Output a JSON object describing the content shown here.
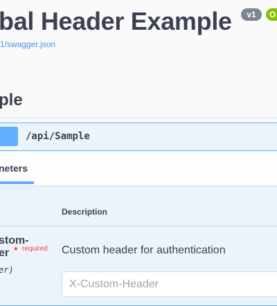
{
  "info": {
    "title": "bal Header Example",
    "version_badge": "v1",
    "oas_badge": "O",
    "spec_url": "1/swagger.json"
  },
  "section": {
    "title": "ple"
  },
  "operation": {
    "path": "/api/Sample",
    "method_color": "#61affe"
  },
  "parameters": {
    "tab_label": "neters",
    "header_description": "Description",
    "items": [
      {
        "name_line1": "stom-",
        "name_line2": "er",
        "required_star": "*",
        "required_label": "required",
        "type": "er)",
        "description": "Custom header for authentication",
        "placeholder": "X-Custom-Header"
      }
    ]
  },
  "colors": {
    "accent": "#61affe",
    "required": "#f93e3e",
    "text": "#3b4151",
    "oas_green": "#89bf04"
  }
}
